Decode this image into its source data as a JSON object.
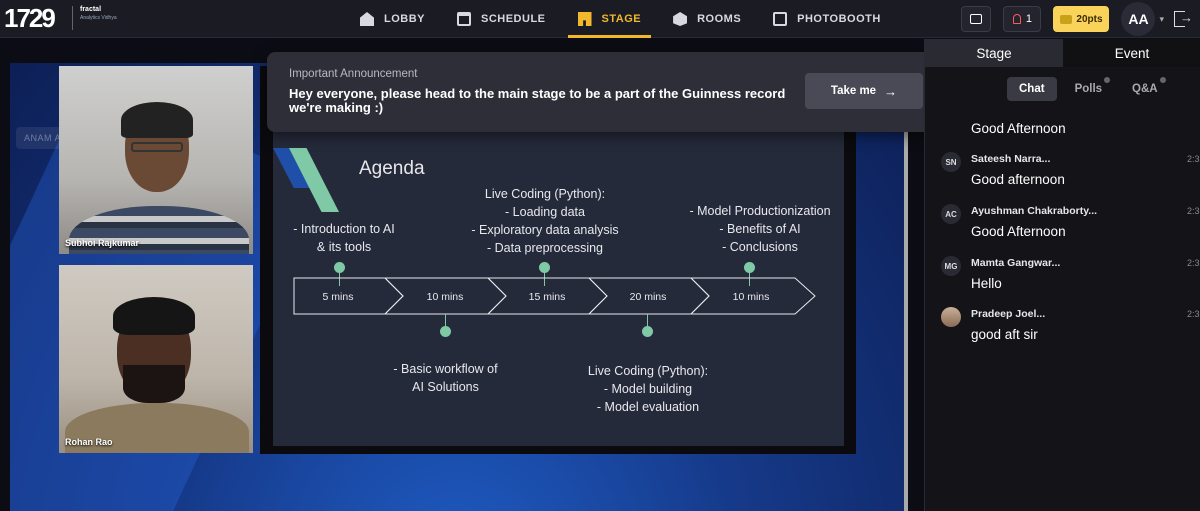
{
  "topbar": {
    "logo": "1729",
    "partner1": "fractal",
    "partner2": "Analytics Vidhya",
    "nav": [
      {
        "label": "LOBBY",
        "icon": "lobby-icon",
        "active": false
      },
      {
        "label": "SCHEDULE",
        "icon": "calendar-icon",
        "active": false
      },
      {
        "label": "STAGE",
        "icon": "stage-icon",
        "active": true
      },
      {
        "label": "ROOMS",
        "icon": "rooms-icon",
        "active": false
      },
      {
        "label": "PHOTOBOOTH",
        "icon": "photobooth-icon",
        "active": false
      }
    ],
    "notification_count": "1",
    "points": "20pts",
    "avatar_initials": "AA"
  },
  "stage": {
    "background_label": "ANAM ALFIYA",
    "speakers": [
      {
        "name": "Subhoi Rajkumar"
      },
      {
        "name": "Rohan Rao"
      }
    ],
    "slide": {
      "title": "Agenda",
      "top_items": [
        [
          "- Introduction to AI",
          "& its tools"
        ],
        [
          "Live Coding (Python):",
          "- Loading data",
          "- Exploratory data analysis",
          "- Data preprocessing"
        ],
        [
          "- Model Productionization",
          "- Benefits of AI",
          "- Conclusions"
        ]
      ],
      "bottom_items": [
        [
          "- Basic workflow of",
          "AI Solutions"
        ],
        [
          "Live Coding (Python):",
          "- Model building",
          "- Model evaluation"
        ]
      ],
      "durations": [
        "5 mins",
        "10 mins",
        "15 mins",
        "20 mins",
        "10 mins"
      ]
    }
  },
  "announcement": {
    "title": "Important Announcement",
    "message": "Hey everyone, please head to the main stage to be a part of the Guinness record we're making :)",
    "button_label": "Take me",
    "close_label": "×"
  },
  "sidebar": {
    "tabs": [
      "Stage",
      "Event"
    ],
    "sub_tabs": [
      "Chat",
      "Polls",
      "Q&A"
    ],
    "messages": [
      {
        "initials": "",
        "name": "",
        "time": "",
        "text": "Good Afternoon"
      },
      {
        "initials": "SN",
        "name": "Sateesh Narra...",
        "time": "2:3",
        "text": "Good afternoon"
      },
      {
        "initials": "AC",
        "name": "Ayushman Chakraborty...",
        "time": "2:3",
        "text": "Good Afternoon"
      },
      {
        "initials": "MG",
        "name": "Mamta Gangwar...",
        "time": "2:3",
        "text": "Hello"
      },
      {
        "initials": "",
        "name": "Pradeep Joel...",
        "time": "2:3",
        "text": "good aft sir"
      }
    ]
  },
  "colors": {
    "accent": "#f1b82d",
    "slide_green": "#7fc9a6",
    "slide_blue": "#1f4fa8",
    "points_bg": "#fad45a"
  }
}
